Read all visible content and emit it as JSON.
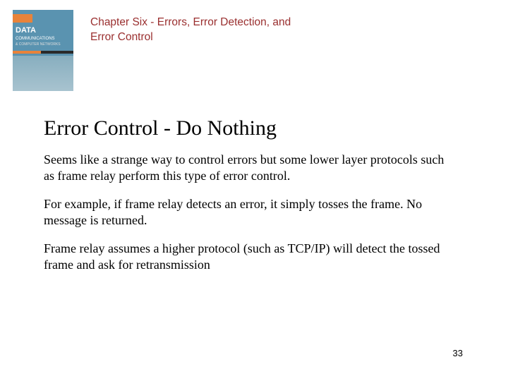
{
  "header": {
    "book_cover": {
      "title_line1": "DATA",
      "title_line2": "COMMUNICATIONS",
      "title_line3": "& COMPUTER NETWORKS"
    },
    "chapter_title": "Chapter Six - Errors, Error Detection, and Error Control"
  },
  "slide": {
    "title": "Error Control - Do Nothing",
    "paragraphs": [
      "Seems like a strange way to control errors but some lower layer protocols such as frame relay perform this type of error control.",
      "For example, if frame relay detects an error, it simply tosses the frame.  No message is returned.",
      "Frame relay assumes a higher protocol (such as TCP/IP) will detect the tossed frame and ask for retransmission"
    ]
  },
  "page_number": "33"
}
